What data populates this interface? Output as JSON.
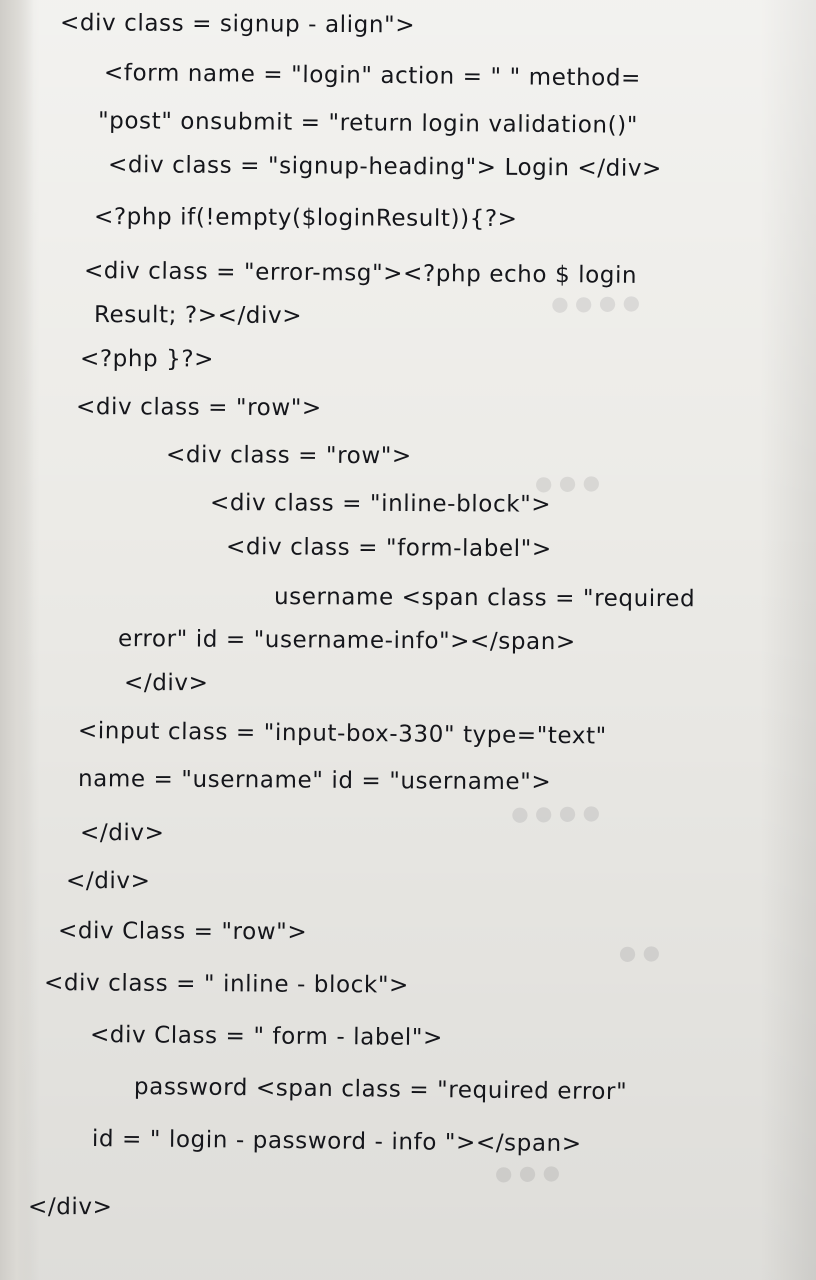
{
  "page": {
    "lines": [
      "<div class = signup - align\">",
      "<form name = \"login\" action = \" \" method=",
      "\"post\" onsubmit = \"return login validation()\"",
      "<div class = \"signup-heading\"> Login </div>",
      "<?php if(!empty($loginResult)){?>",
      "<div class = \"error-msg\"><?php echo $ login",
      "Result; ?></div>",
      "<?php }?>",
      "<div class = \"row\">",
      "<div class = \"row\">",
      "<div class = \"inline-block\">",
      "<div class = \"form-label\">",
      "username <span class = \"required",
      "error\" id = \"username-info\"></span>",
      "</div>",
      "<input class = \"input-box-330\" type=\"text\"",
      "name = \"username\" id = \"username\">",
      "</div>",
      "</div>",
      "<div Class = \"row\">",
      "<div class = \" inline - block\">",
      "<div Class = \" form - label\">",
      "password <span class = \"required error\"",
      "id = \" login - password - info \"></span>",
      "</div>"
    ]
  }
}
